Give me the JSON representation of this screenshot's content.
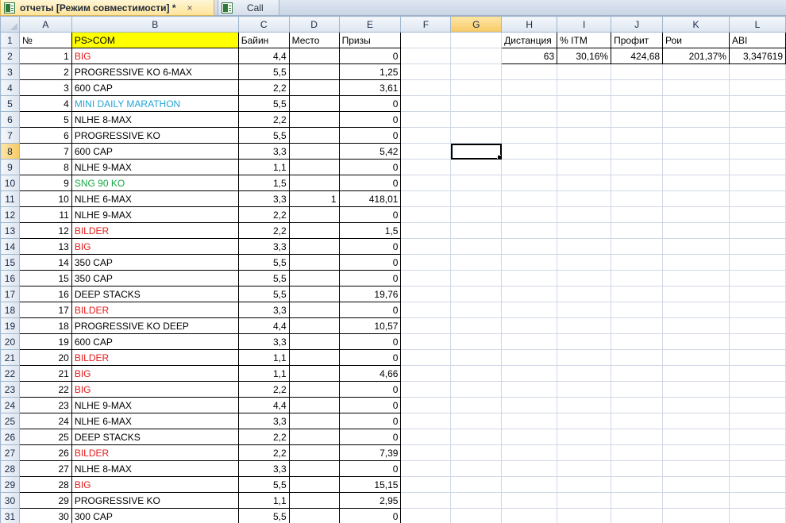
{
  "tabs": [
    {
      "title": "отчеты  [Режим совместимости] *",
      "close": "×"
    },
    {
      "title": "Call"
    }
  ],
  "columns": [
    "A",
    "B",
    "C",
    "D",
    "E",
    "F",
    "G",
    "H",
    "I",
    "J",
    "K",
    "L"
  ],
  "selected_cell": "G8",
  "colors": {
    "red": "#e31b1b",
    "cyan": "#24a4d6",
    "green": "#14a844",
    "header_fill": "#ffff00"
  },
  "header_row": {
    "no": "№",
    "name": "PS>COM",
    "buyin": "Байин",
    "place": "Место",
    "prize": "Призы"
  },
  "stats": {
    "headers": [
      "Дистанция",
      "% ITM",
      "Профит",
      "Рои",
      "ABI"
    ],
    "values": [
      "63",
      "30,16%",
      "424,68",
      "201,37%",
      "3,347619"
    ]
  },
  "rows": [
    {
      "n": "1",
      "name": "BIG",
      "color": "red",
      "buyin": "4,4",
      "place": "",
      "prize": "0"
    },
    {
      "n": "2",
      "name": "PROGRESSIVE KO 6-MAX",
      "color": "",
      "buyin": "5,5",
      "place": "",
      "prize": "1,25"
    },
    {
      "n": "3",
      "name": "600 CAP",
      "color": "",
      "buyin": "2,2",
      "place": "",
      "prize": "3,61"
    },
    {
      "n": "4",
      "name": "MINI DAILY MARATHON",
      "color": "cyan",
      "buyin": "5,5",
      "place": "",
      "prize": "0"
    },
    {
      "n": "5",
      "name": "NLHE 8-MAX",
      "color": "",
      "buyin": "2,2",
      "place": "",
      "prize": "0"
    },
    {
      "n": "6",
      "name": "PROGRESSIVE KO",
      "color": "",
      "buyin": "5,5",
      "place": "",
      "prize": "0"
    },
    {
      "n": "7",
      "name": "600 CAP",
      "color": "",
      "buyin": "3,3",
      "place": "",
      "prize": "5,42"
    },
    {
      "n": "8",
      "name": "NLHE 9-MAX",
      "color": "",
      "buyin": "1,1",
      "place": "",
      "prize": "0"
    },
    {
      "n": "9",
      "name": "SNG 90 KO",
      "color": "green",
      "buyin": "1,5",
      "place": "",
      "prize": "0"
    },
    {
      "n": "10",
      "name": "NLHE 6-MAX",
      "color": "",
      "buyin": "3,3",
      "place": "1",
      "prize": "418,01"
    },
    {
      "n": "11",
      "name": "NLHE 9-MAX",
      "color": "",
      "buyin": "2,2",
      "place": "",
      "prize": "0"
    },
    {
      "n": "12",
      "name": "BILDER",
      "color": "red",
      "buyin": "2,2",
      "place": "",
      "prize": "1,5"
    },
    {
      "n": "13",
      "name": "BIG",
      "color": "red",
      "buyin": "3,3",
      "place": "",
      "prize": "0"
    },
    {
      "n": "14",
      "name": "350 CAP",
      "color": "",
      "buyin": "5,5",
      "place": "",
      "prize": "0"
    },
    {
      "n": "15",
      "name": "350 CAP",
      "color": "",
      "buyin": "5,5",
      "place": "",
      "prize": "0"
    },
    {
      "n": "16",
      "name": "DEEP STACKS",
      "color": "",
      "buyin": "5,5",
      "place": "",
      "prize": "19,76"
    },
    {
      "n": "17",
      "name": "BILDER",
      "color": "red",
      "buyin": "3,3",
      "place": "",
      "prize": "0"
    },
    {
      "n": "18",
      "name": "PROGRESSIVE KO DEEP",
      "color": "",
      "buyin": "4,4",
      "place": "",
      "prize": "10,57"
    },
    {
      "n": "19",
      "name": "600 CAP",
      "color": "",
      "buyin": "3,3",
      "place": "",
      "prize": "0"
    },
    {
      "n": "20",
      "name": "BILDER",
      "color": "red",
      "buyin": "1,1",
      "place": "",
      "prize": "0"
    },
    {
      "n": "21",
      "name": "BIG",
      "color": "red",
      "buyin": "1,1",
      "place": "",
      "prize": "4,66"
    },
    {
      "n": "22",
      "name": "BIG",
      "color": "red",
      "buyin": "2,2",
      "place": "",
      "prize": "0"
    },
    {
      "n": "23",
      "name": "NLHE 9-MAX",
      "color": "",
      "buyin": "4,4",
      "place": "",
      "prize": "0"
    },
    {
      "n": "24",
      "name": "NLHE 6-MAX",
      "color": "",
      "buyin": "3,3",
      "place": "",
      "prize": "0"
    },
    {
      "n": "25",
      "name": "DEEP STACKS",
      "color": "",
      "buyin": "2,2",
      "place": "",
      "prize": "0"
    },
    {
      "n": "26",
      "name": "BILDER",
      "color": "red",
      "buyin": "2,2",
      "place": "",
      "prize": "7,39"
    },
    {
      "n": "27",
      "name": "NLHE 8-MAX",
      "color": "",
      "buyin": "3,3",
      "place": "",
      "prize": "0"
    },
    {
      "n": "28",
      "name": "BIG",
      "color": "red",
      "buyin": "5,5",
      "place": "",
      "prize": "15,15"
    },
    {
      "n": "29",
      "name": "PROGRESSIVE KO",
      "color": "",
      "buyin": "1,1",
      "place": "",
      "prize": "2,95"
    },
    {
      "n": "30",
      "name": "300 CAP",
      "color": "",
      "buyin": "5,5",
      "place": "",
      "prize": "0"
    }
  ]
}
